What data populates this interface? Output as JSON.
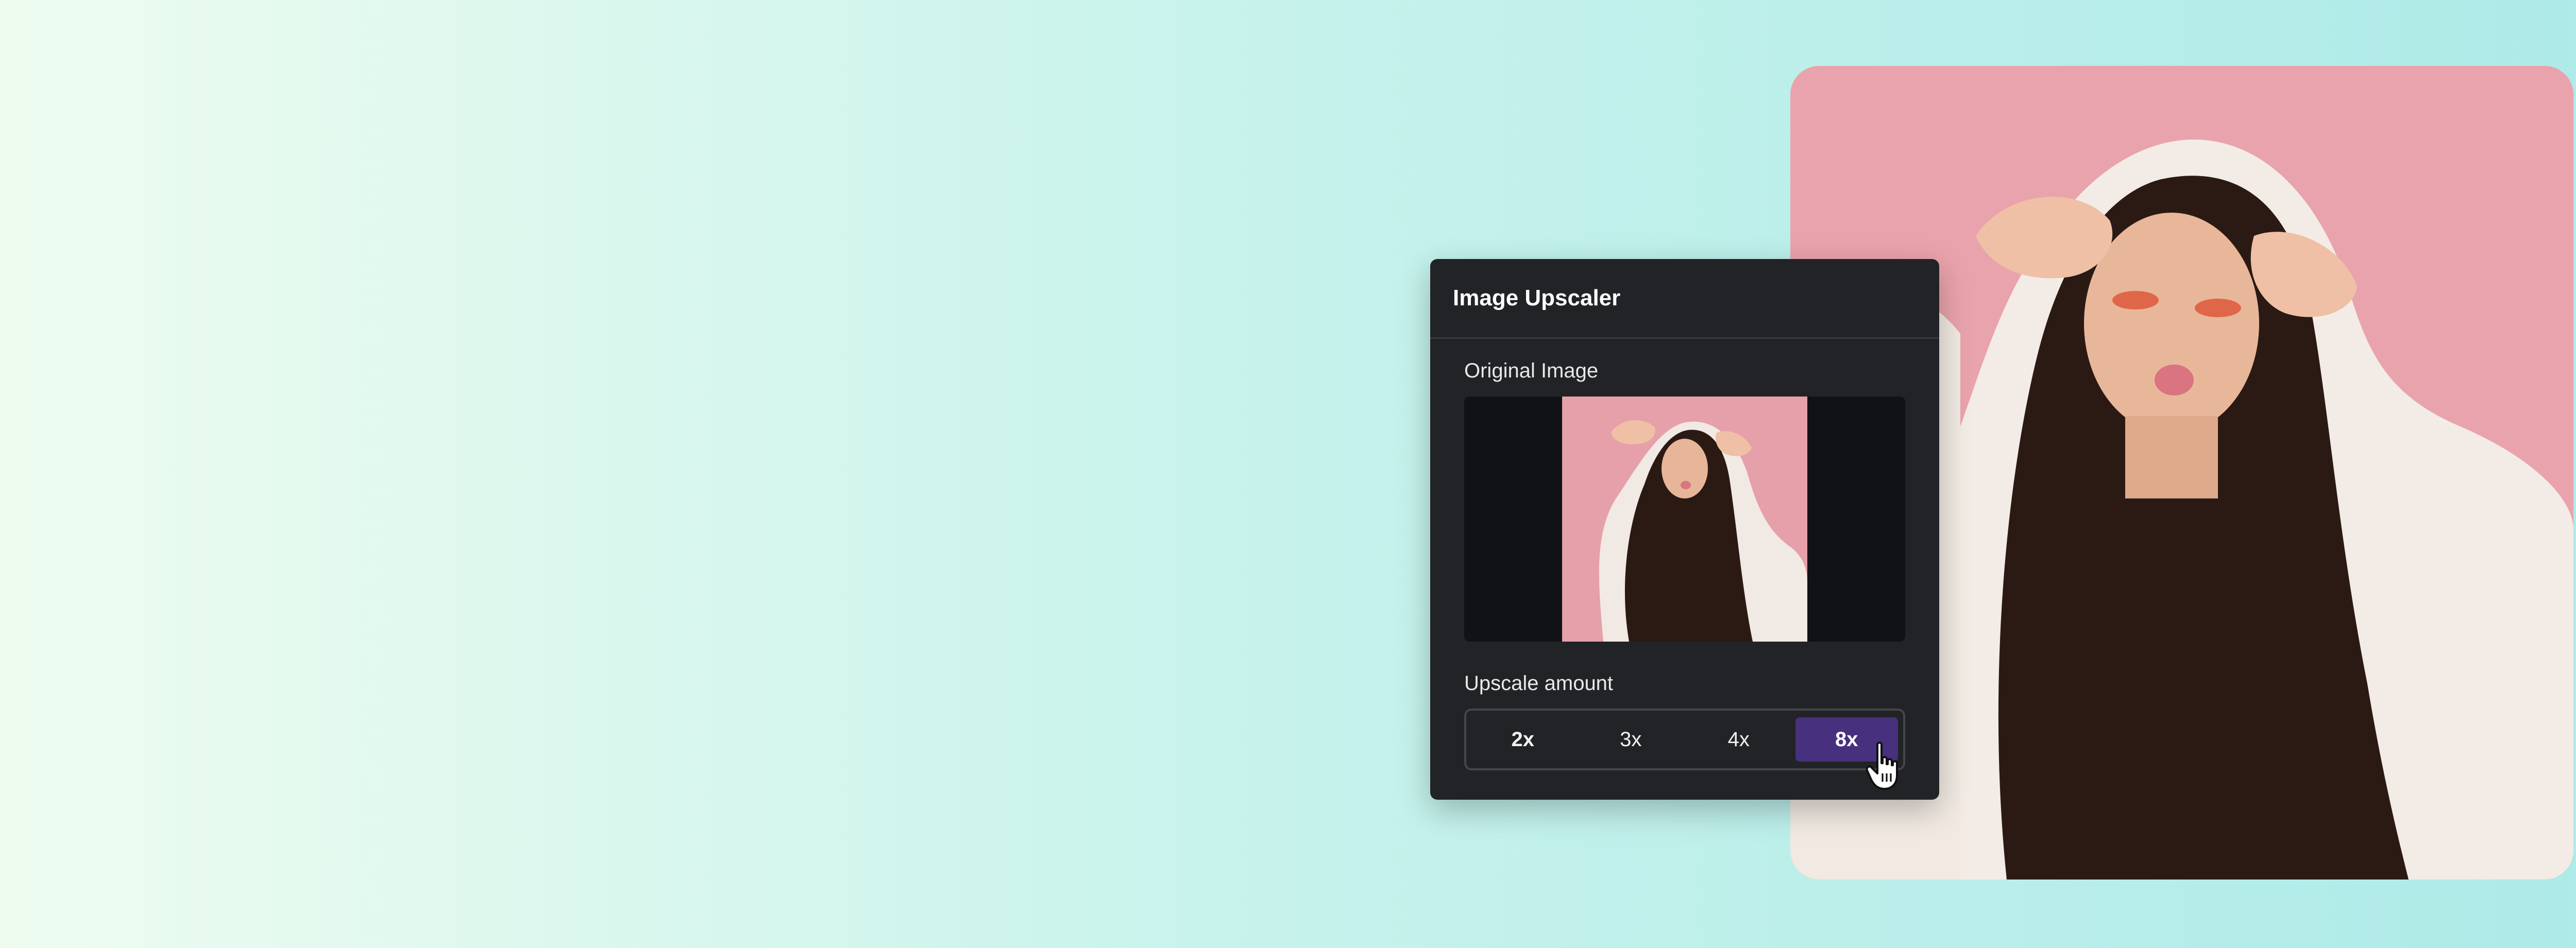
{
  "panel": {
    "title": "Image Upscaler",
    "original_label": "Original Image",
    "upscale_label": "Upscale amount",
    "options": [
      {
        "label": "2x",
        "selected": false
      },
      {
        "label": "3x",
        "selected": false
      },
      {
        "label": "4x",
        "selected": false
      },
      {
        "label": "8x",
        "selected": true
      }
    ]
  },
  "colors": {
    "panel_bg": "#222326",
    "selected_option": "#47307e",
    "photo_bg": "#e9a3ac",
    "background_left": "#eefcf0",
    "background_right": "#aeeae8"
  },
  "icons": {
    "cursor": "hand-pointer-icon"
  }
}
